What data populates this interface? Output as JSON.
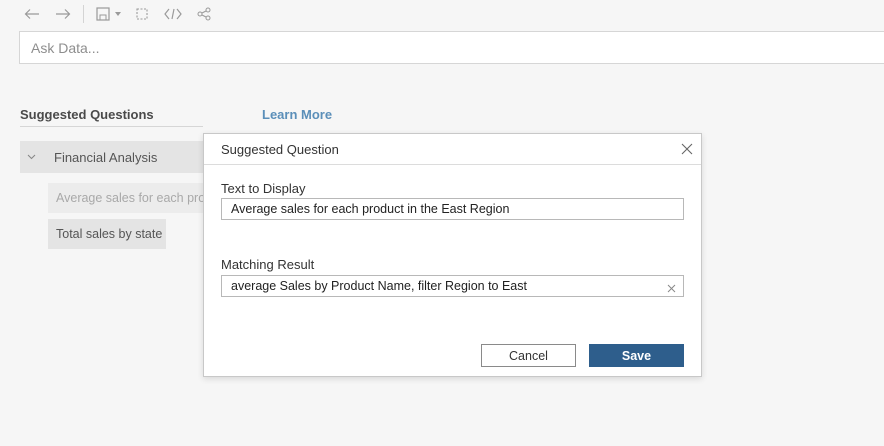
{
  "toolbar": {
    "icons": [
      "back-icon",
      "forward-icon",
      "save-icon",
      "save-dropdown-icon",
      "present-icon",
      "embed-code-icon",
      "share-icon"
    ]
  },
  "ask_data": {
    "placeholder": "Ask Data..."
  },
  "suggestions": {
    "heading": "Suggested Questions",
    "learn_more": "Learn More",
    "group": {
      "label": "Financial Analysis",
      "expanded": true,
      "items": [
        "Average sales for each prod",
        "Total sales by state"
      ]
    }
  },
  "dialog": {
    "title": "Suggested Question",
    "text_label": "Text to Display",
    "text_value": "Average sales for each product in the East Region",
    "match_label": "Matching Result",
    "match_value": "average Sales by Product Name, filter Region to East",
    "cancel_label": "Cancel",
    "save_label": "Save"
  },
  "colors": {
    "save_button": "#2e5e8c",
    "link": "#5b8fb9",
    "background": "#f6f6f6"
  }
}
